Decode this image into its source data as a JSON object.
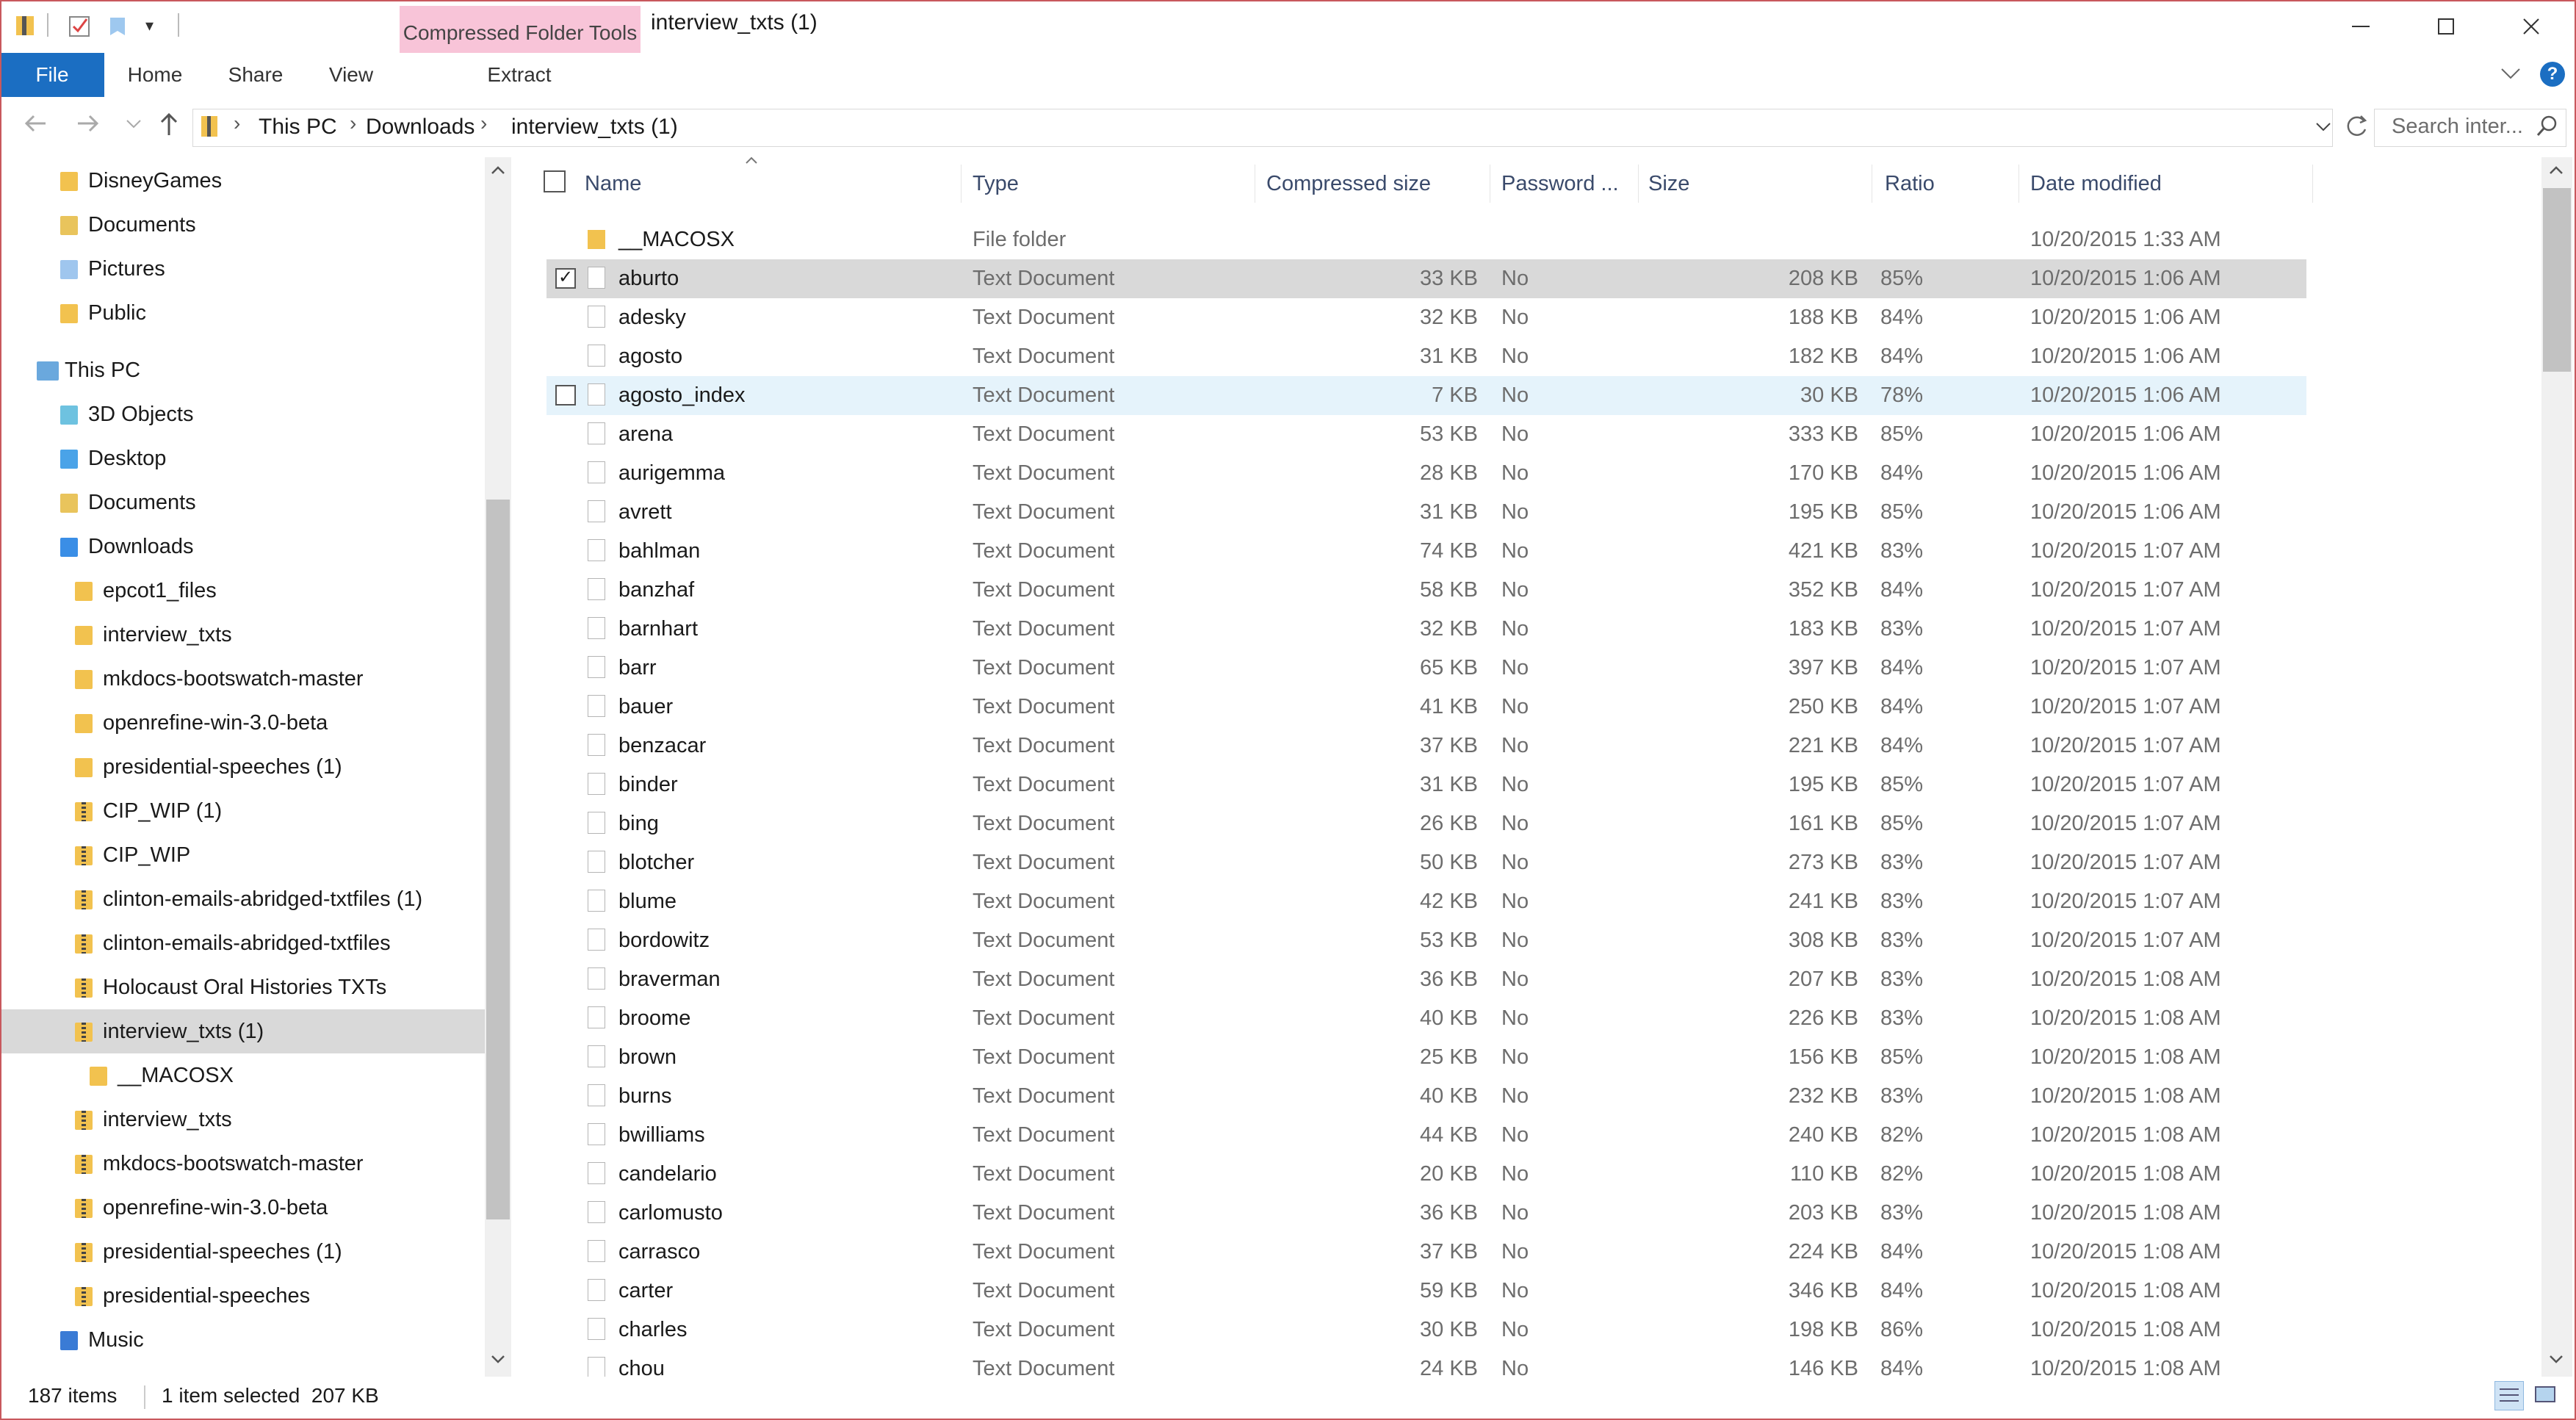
{
  "window": {
    "title": "interview_txts (1)",
    "context_tab_header": "Compressed Folder Tools",
    "minimize": "—",
    "maximize": "☐",
    "close": "✕"
  },
  "ribbon": {
    "tabs": [
      "File",
      "Home",
      "Share",
      "View",
      "Extract"
    ],
    "help": "?"
  },
  "address": {
    "crumbs": [
      "This PC",
      "Downloads",
      "interview_txts (1)"
    ],
    "search_placeholder": "Search inter..."
  },
  "nav": {
    "items": [
      {
        "label": "DisneyGames",
        "icon": "folder-icon"
      },
      {
        "label": "Documents",
        "icon": "documents-folder-icon"
      },
      {
        "label": "Pictures",
        "icon": "pictures-folder-icon"
      },
      {
        "label": "Public",
        "icon": "folder-icon"
      },
      {
        "label": "This PC",
        "icon": "computer-icon"
      },
      {
        "label": "3D Objects",
        "icon": "3d-objects-icon"
      },
      {
        "label": "Desktop",
        "icon": "desktop-folder-icon"
      },
      {
        "label": "Documents",
        "icon": "documents-folder-icon"
      },
      {
        "label": "Downloads",
        "icon": "downloads-folder-icon"
      },
      {
        "label": "epcot1_files",
        "icon": "folder-icon"
      },
      {
        "label": "interview_txts",
        "icon": "folder-icon"
      },
      {
        "label": "mkdocs-bootswatch-master",
        "icon": "folder-icon"
      },
      {
        "label": "openrefine-win-3.0-beta",
        "icon": "folder-icon"
      },
      {
        "label": "presidential-speeches (1)",
        "icon": "folder-icon"
      },
      {
        "label": "CIP_WIP (1)",
        "icon": "zip-folder-icon"
      },
      {
        "label": "CIP_WIP",
        "icon": "zip-folder-icon"
      },
      {
        "label": "clinton-emails-abridged-txtfiles (1)",
        "icon": "zip-folder-icon"
      },
      {
        "label": "clinton-emails-abridged-txtfiles",
        "icon": "zip-folder-icon"
      },
      {
        "label": "Holocaust Oral Histories TXTs",
        "icon": "zip-folder-icon"
      },
      {
        "label": "interview_txts (1)",
        "icon": "zip-folder-icon"
      },
      {
        "label": "__MACOSX",
        "icon": "folder-icon"
      },
      {
        "label": "interview_txts",
        "icon": "zip-folder-icon"
      },
      {
        "label": "mkdocs-bootswatch-master",
        "icon": "zip-folder-icon"
      },
      {
        "label": "openrefine-win-3.0-beta",
        "icon": "zip-folder-icon"
      },
      {
        "label": "presidential-speeches (1)",
        "icon": "zip-folder-icon"
      },
      {
        "label": "presidential-speeches",
        "icon": "zip-folder-icon"
      },
      {
        "label": "Music",
        "icon": "music-folder-icon"
      }
    ],
    "selected_index": 19
  },
  "list": {
    "columns": [
      "Name",
      "Type",
      "Compressed size",
      "Password ...",
      "Size",
      "Ratio",
      "Date modified"
    ],
    "rows": [
      {
        "name": "__MACOSX",
        "type": "File folder",
        "csize": "",
        "pw": "",
        "size": "",
        "ratio": "",
        "date": "10/20/2015 1:33 AM",
        "folder": true
      },
      {
        "name": "aburto",
        "type": "Text Document",
        "csize": "33 KB",
        "pw": "No",
        "size": "208 KB",
        "ratio": "85%",
        "date": "10/20/2015 1:06 AM",
        "selected": true
      },
      {
        "name": "adesky",
        "type": "Text Document",
        "csize": "32 KB",
        "pw": "No",
        "size": "188 KB",
        "ratio": "84%",
        "date": "10/20/2015 1:06 AM"
      },
      {
        "name": "agosto",
        "type": "Text Document",
        "csize": "31 KB",
        "pw": "No",
        "size": "182 KB",
        "ratio": "84%",
        "date": "10/20/2015 1:06 AM"
      },
      {
        "name": "agosto_index",
        "type": "Text Document",
        "csize": "7 KB",
        "pw": "No",
        "size": "30 KB",
        "ratio": "78%",
        "date": "10/20/2015 1:06 AM",
        "hover": true
      },
      {
        "name": "arena",
        "type": "Text Document",
        "csize": "53 KB",
        "pw": "No",
        "size": "333 KB",
        "ratio": "85%",
        "date": "10/20/2015 1:06 AM"
      },
      {
        "name": "aurigemma",
        "type": "Text Document",
        "csize": "28 KB",
        "pw": "No",
        "size": "170 KB",
        "ratio": "84%",
        "date": "10/20/2015 1:06 AM"
      },
      {
        "name": "avrett",
        "type": "Text Document",
        "csize": "31 KB",
        "pw": "No",
        "size": "195 KB",
        "ratio": "85%",
        "date": "10/20/2015 1:06 AM"
      },
      {
        "name": "bahlman",
        "type": "Text Document",
        "csize": "74 KB",
        "pw": "No",
        "size": "421 KB",
        "ratio": "83%",
        "date": "10/20/2015 1:07 AM"
      },
      {
        "name": "banzhaf",
        "type": "Text Document",
        "csize": "58 KB",
        "pw": "No",
        "size": "352 KB",
        "ratio": "84%",
        "date": "10/20/2015 1:07 AM"
      },
      {
        "name": "barnhart",
        "type": "Text Document",
        "csize": "32 KB",
        "pw": "No",
        "size": "183 KB",
        "ratio": "83%",
        "date": "10/20/2015 1:07 AM"
      },
      {
        "name": "barr",
        "type": "Text Document",
        "csize": "65 KB",
        "pw": "No",
        "size": "397 KB",
        "ratio": "84%",
        "date": "10/20/2015 1:07 AM"
      },
      {
        "name": "bauer",
        "type": "Text Document",
        "csize": "41 KB",
        "pw": "No",
        "size": "250 KB",
        "ratio": "84%",
        "date": "10/20/2015 1:07 AM"
      },
      {
        "name": "benzacar",
        "type": "Text Document",
        "csize": "37 KB",
        "pw": "No",
        "size": "221 KB",
        "ratio": "84%",
        "date": "10/20/2015 1:07 AM"
      },
      {
        "name": "binder",
        "type": "Text Document",
        "csize": "31 KB",
        "pw": "No",
        "size": "195 KB",
        "ratio": "85%",
        "date": "10/20/2015 1:07 AM"
      },
      {
        "name": "bing",
        "type": "Text Document",
        "csize": "26 KB",
        "pw": "No",
        "size": "161 KB",
        "ratio": "85%",
        "date": "10/20/2015 1:07 AM"
      },
      {
        "name": "blotcher",
        "type": "Text Document",
        "csize": "50 KB",
        "pw": "No",
        "size": "273 KB",
        "ratio": "83%",
        "date": "10/20/2015 1:07 AM"
      },
      {
        "name": "blume",
        "type": "Text Document",
        "csize": "42 KB",
        "pw": "No",
        "size": "241 KB",
        "ratio": "83%",
        "date": "10/20/2015 1:07 AM"
      },
      {
        "name": "bordowitz",
        "type": "Text Document",
        "csize": "53 KB",
        "pw": "No",
        "size": "308 KB",
        "ratio": "83%",
        "date": "10/20/2015 1:07 AM"
      },
      {
        "name": "braverman",
        "type": "Text Document",
        "csize": "36 KB",
        "pw": "No",
        "size": "207 KB",
        "ratio": "83%",
        "date": "10/20/2015 1:08 AM"
      },
      {
        "name": "broome",
        "type": "Text Document",
        "csize": "40 KB",
        "pw": "No",
        "size": "226 KB",
        "ratio": "83%",
        "date": "10/20/2015 1:08 AM"
      },
      {
        "name": "brown",
        "type": "Text Document",
        "csize": "25 KB",
        "pw": "No",
        "size": "156 KB",
        "ratio": "85%",
        "date": "10/20/2015 1:08 AM"
      },
      {
        "name": "burns",
        "type": "Text Document",
        "csize": "40 KB",
        "pw": "No",
        "size": "232 KB",
        "ratio": "83%",
        "date": "10/20/2015 1:08 AM"
      },
      {
        "name": "bwilliams",
        "type": "Text Document",
        "csize": "44 KB",
        "pw": "No",
        "size": "240 KB",
        "ratio": "82%",
        "date": "10/20/2015 1:08 AM"
      },
      {
        "name": "candelario",
        "type": "Text Document",
        "csize": "20 KB",
        "pw": "No",
        "size": "110 KB",
        "ratio": "82%",
        "date": "10/20/2015 1:08 AM"
      },
      {
        "name": "carlomusto",
        "type": "Text Document",
        "csize": "36 KB",
        "pw": "No",
        "size": "203 KB",
        "ratio": "83%",
        "date": "10/20/2015 1:08 AM"
      },
      {
        "name": "carrasco",
        "type": "Text Document",
        "csize": "37 KB",
        "pw": "No",
        "size": "224 KB",
        "ratio": "84%",
        "date": "10/20/2015 1:08 AM"
      },
      {
        "name": "carter",
        "type": "Text Document",
        "csize": "59 KB",
        "pw": "No",
        "size": "346 KB",
        "ratio": "84%",
        "date": "10/20/2015 1:08 AM"
      },
      {
        "name": "charles",
        "type": "Text Document",
        "csize": "30 KB",
        "pw": "No",
        "size": "198 KB",
        "ratio": "86%",
        "date": "10/20/2015 1:08 AM"
      },
      {
        "name": "chou",
        "type": "Text Document",
        "csize": "24 KB",
        "pw": "No",
        "size": "146 KB",
        "ratio": "84%",
        "date": "10/20/2015 1:08 AM"
      }
    ]
  },
  "status": {
    "count": "187 items",
    "selection": "1 item selected  207 KB"
  }
}
